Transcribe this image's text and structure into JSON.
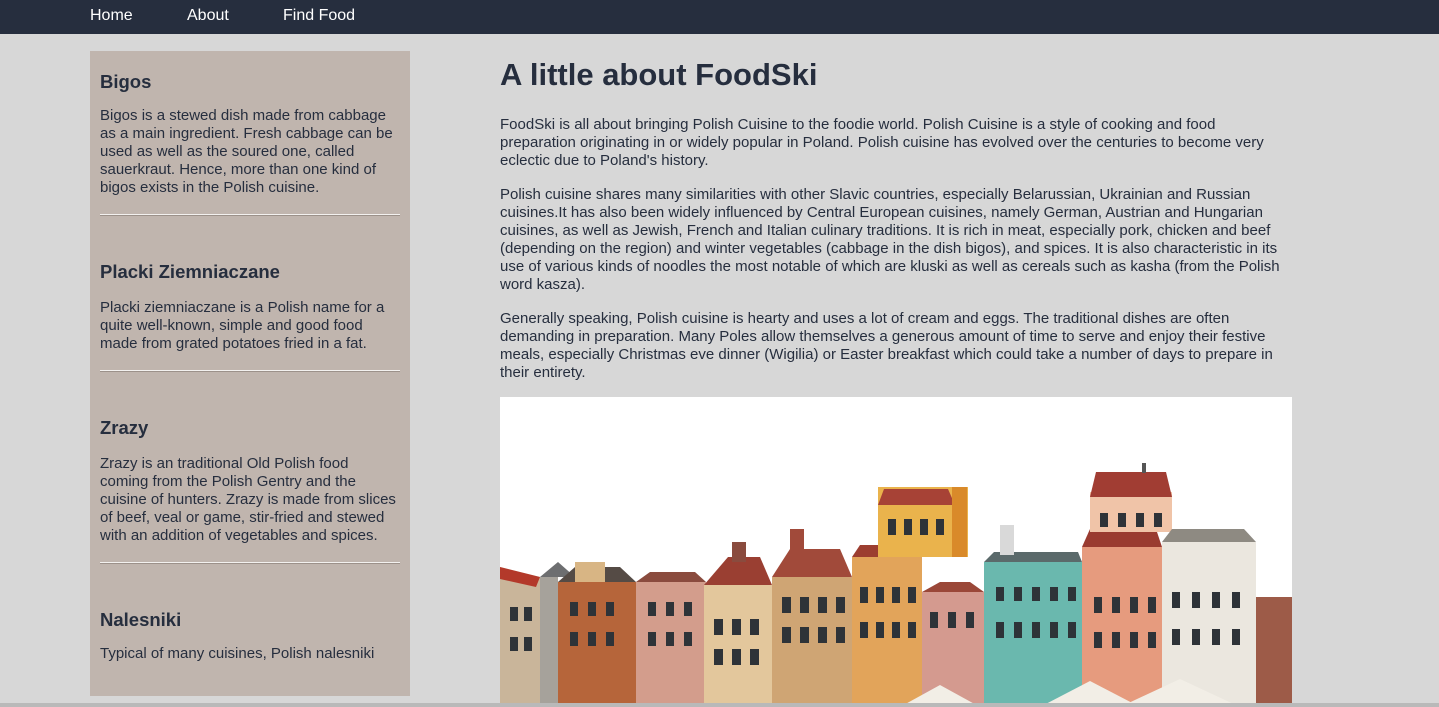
{
  "nav": {
    "items": [
      "Home",
      "About",
      "Find Food"
    ]
  },
  "sidebar": {
    "dishes": [
      {
        "title": "Bigos",
        "text": "Bigos is a stewed dish made from cabbage as a main ingredient. Fresh cabbage can be used as well as the soured one, called sauerkraut. Hence, more than one kind of bigos exists in the Polish cuisine."
      },
      {
        "title": "Placki Ziemniaczane",
        "text": "Placki ziemniaczane is a Polish name for a quite well-known, simple and good food made from grated potatoes fried in a fat."
      },
      {
        "title": "Zrazy",
        "text": "Zrazy is an traditional Old Polish food coming from the Polish Gentry and the cuisine of hunters. Zrazy is made from slices of beef, veal or game, stir-fried and stewed with an addition of vegetables and spices."
      },
      {
        "title": "Nalesniki",
        "text": "Typical of many cuisines, Polish nalesniki"
      }
    ]
  },
  "main": {
    "title": "A little about FoodSki",
    "paragraphs": [
      "FoodSki is all about bringing Polish Cuisine to the foodie world. Polish Cuisine is a style of cooking and food preparation originating in or widely popular in Poland. Polish cuisine has evolved over the centuries to become very eclectic due to Poland's history.",
      "Polish cuisine shares many similarities with other Slavic countries, especially Belarussian, Ukrainian and Russian cuisines.It has also been widely influenced by Central European cuisines, namely German, Austrian and Hungarian cuisines, as well as Jewish, French and Italian culinary traditions. It is rich in meat, especially pork, chicken and beef (depending on the region) and winter vegetables (cabbage in the dish bigos), and spices. It is also characteristic in its use of various kinds of noodles the most notable of which are kluski as well as cereals such as kasha (from the Polish word kasza).",
      "Generally speaking, Polish cuisine is hearty and uses a lot of cream and eggs. The traditional dishes are often demanding in preparation. Many Poles allow themselves a generous amount of time to serve and enjoy their festive meals, especially Christmas eve dinner (Wigilia) or Easter breakfast which could take a number of days to prepare in their entirety."
    ]
  },
  "colors": {
    "nav_bg": "#262e3e",
    "sidebar_bg": "#c0b5ae",
    "page_bg": "#d7d7d7",
    "text": "#262e3e"
  }
}
